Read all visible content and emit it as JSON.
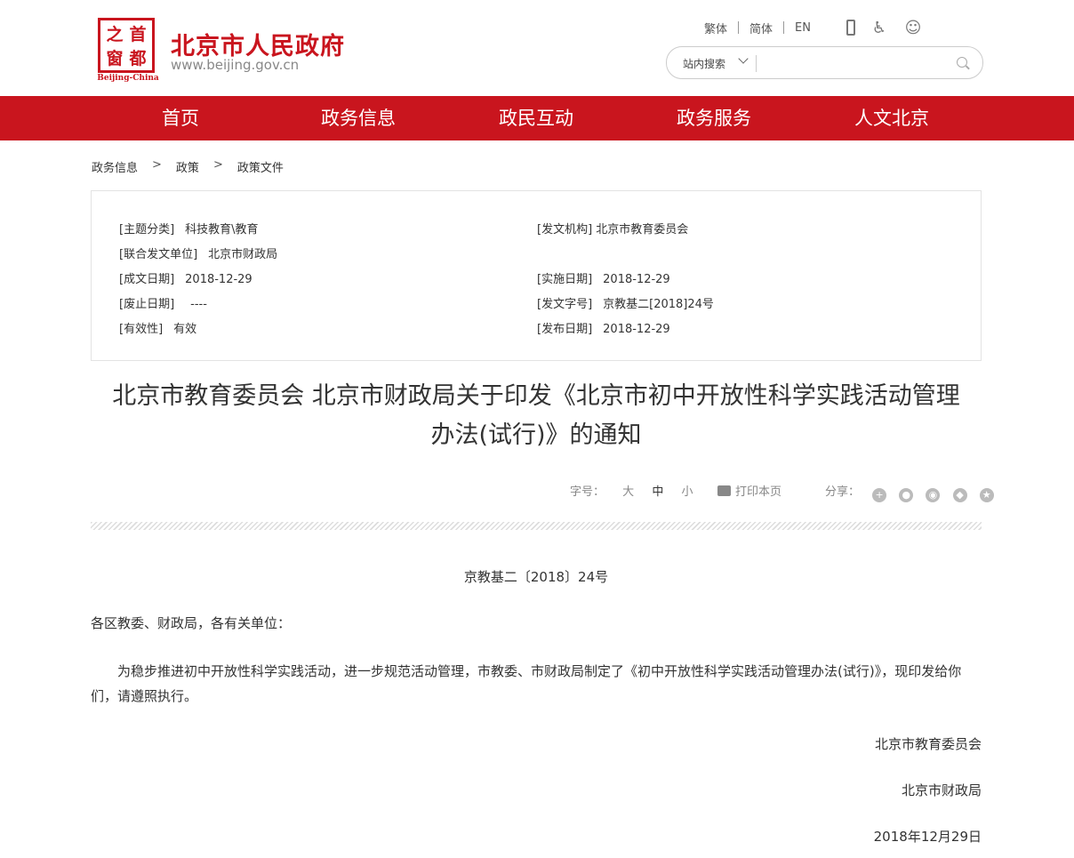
{
  "header": {
    "logo_chars": [
      "首",
      "之",
      "都",
      "窗"
    ],
    "logo_sub": "Beijing-China",
    "site_title": "北京市人民政府",
    "site_url": "www.beijing.gov.cn",
    "lang_options": [
      "繁体",
      "简体",
      "EN"
    ],
    "icons": [
      "mobile-icon",
      "accessibility-icon",
      "elder-mode-icon"
    ],
    "search_scope": "站内搜索",
    "search_value": "",
    "brand_color": "#c9151e"
  },
  "nav": {
    "items": [
      "首页",
      "政务信息",
      "政民互动",
      "政务服务",
      "人文北京"
    ]
  },
  "breadcrumb": {
    "sep": ">",
    "items": [
      "政务信息",
      "政策",
      "政策文件"
    ]
  },
  "meta": {
    "topic_key": "[主题分类]",
    "topic_val": "科技教育\\教育",
    "issuer_key": "[发文机构]",
    "issuer_val": "北京市教育委员会",
    "joint_key": "[联合发文单位]",
    "joint_val": "北京市财政局",
    "created_key": "[成文日期]",
    "created_val": "2018-12-29",
    "effective_key": "[实施日期]",
    "effective_val": "2018-12-29",
    "abolish_key": "[废止日期]",
    "abolish_val": "----",
    "docno_key": "[发文字号]",
    "docno_val": "京教基二[2018]24号",
    "validity_key": "[有效性]",
    "validity_val": "有效",
    "published_key": "[发布日期]",
    "published_val": "2018-12-29"
  },
  "title": {
    "line1": "北京市教育委员会 北京市财政局关于印发《北京市初中开放性科学实践活动管理",
    "line2": "办法(试行)》的通知"
  },
  "tools": {
    "font_size_label": "字号：",
    "sizes": [
      "大",
      "中",
      "小"
    ],
    "print_label": "打印本页",
    "share_label": "分享：",
    "share_icons": [
      "qzone-icon",
      "wechat-icon",
      "weibo-icon",
      "qq-icon",
      "favorite-icon"
    ]
  },
  "body": {
    "doc_number": "京教基二〔2018〕24号",
    "salutation": "各区教委、财政局，各有关单位：",
    "paragraph": "为稳步推进初中开放性科学实践活动，进一步规范活动管理，市教委、市财政局制定了《初中开放性科学实践活动管理办法(试行)》，现印发给你们，请遵照执行。",
    "signatures": [
      "北京市教育委员会",
      "北京市财政局",
      "2018年12月29日"
    ]
  }
}
